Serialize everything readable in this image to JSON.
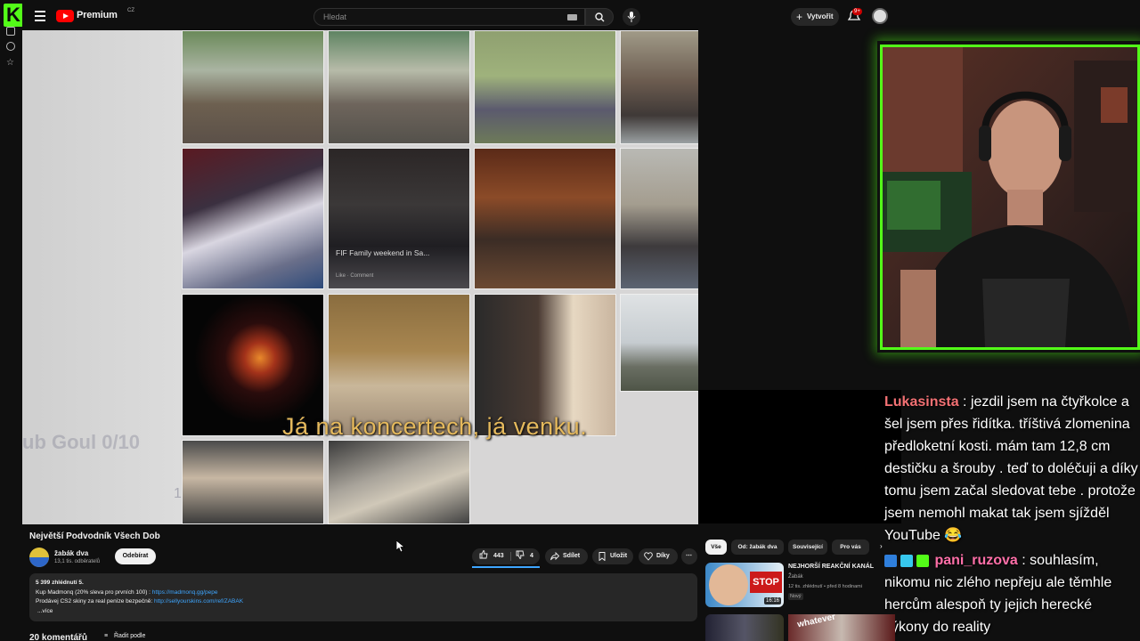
{
  "colors": {
    "kick_green": "#53fc18",
    "yt_red": "#ff0000",
    "link_blue": "#3ea6ff",
    "subtitle_yellow": "#e5b95c"
  },
  "kick": {
    "logo": "K"
  },
  "topbar": {
    "brand": "Premium",
    "country": "CZ",
    "search_placeholder": "Hledat",
    "create_label": "Vytvořit",
    "notification_count": "9+"
  },
  "video": {
    "subtitle": "Já na koncertech, já venku.",
    "bg_text": "ub Goul 0/10",
    "bg_number": "1,027",
    "photo_caption": "FIF Family weekend in Sa...",
    "photo_sub": "Like · Comment"
  },
  "info": {
    "title": "Největší Podvodník Všech Dob",
    "channel_name": "žabák dva",
    "channel_subs": "13,1 tis. odběratelů",
    "subscribe_label": "Odebírat",
    "likes": "443",
    "dislikes": "4",
    "share_label": "Sdílet",
    "save_label": "Uložit",
    "thanks_label": "Díky",
    "more_label": "⋯"
  },
  "description": {
    "views": "5 399 zhlédnutí  5.",
    "line1_text": "Kup Madmonq (20% sleva pro prvních 100) : ",
    "line1_link": "https://madmonq.gg/pepe",
    "line2_text": "Prodávej CS2 skiny za real peníze bezpečně: ",
    "line2_link": "http://sellyourskins.com/ref/ZABAK",
    "more": "...více"
  },
  "comments": {
    "count": "20 komentářů",
    "sort_label": "Řadit podle"
  },
  "chips": [
    "Vše",
    "Od: žabák dva",
    "Související",
    "Pro vás"
  ],
  "recommendation": {
    "title": "NEJHORŠÍ REAKČNÍ KANÁL",
    "channel": "Žabák",
    "meta": "12 tis. zhlédnutí • před 8 hodinami",
    "badge": "Nový",
    "duration": "16:16",
    "thumb_text": "STOP"
  },
  "rec3": {
    "thumb_text": "whatever"
  },
  "chat": [
    {
      "user": "Lukasinsta",
      "sep": " : ",
      "text": "jezdil jsem na čtyřkolce a šel jsem přes řidítka. tříštivá zlomenina předloketní kosti. mám tam 12,8 cm destičku a šrouby . teď to doléčuji a díky tomu jsem začal sledovat tebe . protože jsem nemohl makat tak jsem sjížděl YouTube 😂"
    },
    {
      "user": "pani_ruzova",
      "sep": " : ",
      "text": "souhlasím, nikomu nic zlého nepřeju ale těmhle hercům alespoň ty jejich herecké výkony do reality"
    }
  ]
}
